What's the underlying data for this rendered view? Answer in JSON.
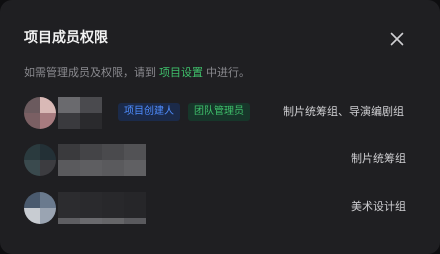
{
  "dialog": {
    "title": "项目成员权限",
    "close_icon": "close-icon",
    "hint_prefix": "如需管理成员及权限，请到",
    "hint_link": "项目设置",
    "hint_suffix": "中进行。"
  },
  "members": [
    {
      "name": "",
      "badges": [
        "项目创建人",
        "团队管理员"
      ],
      "groups": "制片统筹组、导演编剧组"
    },
    {
      "name": "",
      "badges": [],
      "groups": "制片统筹组"
    },
    {
      "name": "",
      "badges": [],
      "groups": "美术设计组"
    }
  ],
  "colors": {
    "background": "#1f1f22",
    "link": "#3fc06b",
    "badge_creator_bg": "#1b2a49",
    "badge_creator_text": "#4f8dff",
    "badge_admin_bg": "#17362a",
    "badge_admin_text": "#3fc06b"
  }
}
